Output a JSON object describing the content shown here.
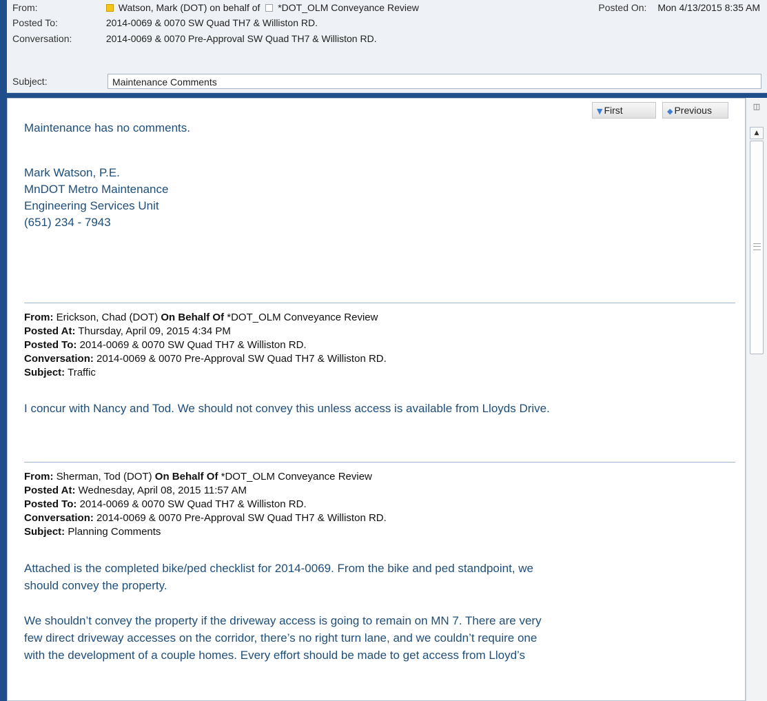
{
  "header": {
    "from_label": "From:",
    "from_value_1": "Watson, Mark (DOT) on behalf of",
    "from_value_2": "*DOT_OLM Conveyance Review",
    "posted_on_label": "Posted On:",
    "posted_on_value": "Mon 4/13/2015 8:35 AM",
    "posted_to_label": "Posted To:",
    "posted_to_value": "2014-0069 & 0070 SW Quad TH7 & Williston RD.",
    "conversation_label": "Conversation:",
    "conversation_value": "2014-0069 & 0070 Pre-Approval SW Quad TH7 & Williston RD.",
    "subject_label": "Subject:",
    "subject_value": "Maintenance Comments"
  },
  "nav": {
    "first_label": "First",
    "previous_label": "Previous"
  },
  "message": {
    "line1": "Maintenance has no comments.",
    "sig_name": "Mark Watson, P.E.",
    "sig_org": "MnDOT Metro Maintenance",
    "sig_unit": "Engineering Services Unit",
    "sig_phone": "(651) 234 - 7943"
  },
  "quoted1": {
    "from_label": "From:",
    "from_value": "Erickson, Chad (DOT)",
    "behalf_label": "On Behalf Of",
    "behalf_value": "*DOT_OLM Conveyance Review",
    "posted_at_label": "Posted At:",
    "posted_at_value": "Thursday, April 09, 2015 4:34 PM",
    "posted_to_label": "Posted To:",
    "posted_to_value": "2014-0069 & 0070 SW Quad TH7 & Williston RD.",
    "conversation_label": "Conversation:",
    "conversation_value": "2014-0069 & 0070 Pre-Approval SW Quad TH7 & Williston RD.",
    "subject_label": "Subject:",
    "subject_value": "Traffic",
    "body": "I concur with Nancy and Tod.  We should not convey this unless access is available from Lloyds Drive."
  },
  "quoted2": {
    "from_label": "From:",
    "from_value": "Sherman, Tod (DOT)",
    "behalf_label": "On Behalf Of",
    "behalf_value": "*DOT_OLM Conveyance Review",
    "posted_at_label": "Posted At:",
    "posted_at_value": "Wednesday, April 08, 2015 11:57 AM",
    "posted_to_label": "Posted To:",
    "posted_to_value": "2014-0069 & 0070 SW Quad TH7 & Williston RD.",
    "conversation_label": "Conversation:",
    "conversation_value": "2014-0069 & 0070 Pre-Approval SW Quad TH7 & Williston RD.",
    "subject_label": "Subject:",
    "subject_value": "Planning Comments",
    "body1_line1": "Attached is the completed bike/ped checklist for 2014-0069.  From the bike and ped standpoint, we",
    "body1_line2": "should convey the property.",
    "body2_line1": "We shouldn’t convey the property if the driveway access is going to remain on MN 7.  There are very",
    "body2_line2": "few direct driveway accesses on the corridor, there’s no right turn lane, and we couldn’t require one",
    "body2_line3": "with the development of a couple homes.  Every effort should be made to get access from Lloyd’s"
  },
  "icons": {
    "category": "yellow-category-square",
    "public_folder": "folder-checkbox-icon",
    "first_arrow": "double-down-arrow-icon",
    "previous_arrow": "up-arrow-icon",
    "scroll_up": "scroll-up-arrow-icon"
  },
  "colors": {
    "frame": "#1f4e8a",
    "body_text": "#1f4e79",
    "separator": "#9fb6d3"
  }
}
